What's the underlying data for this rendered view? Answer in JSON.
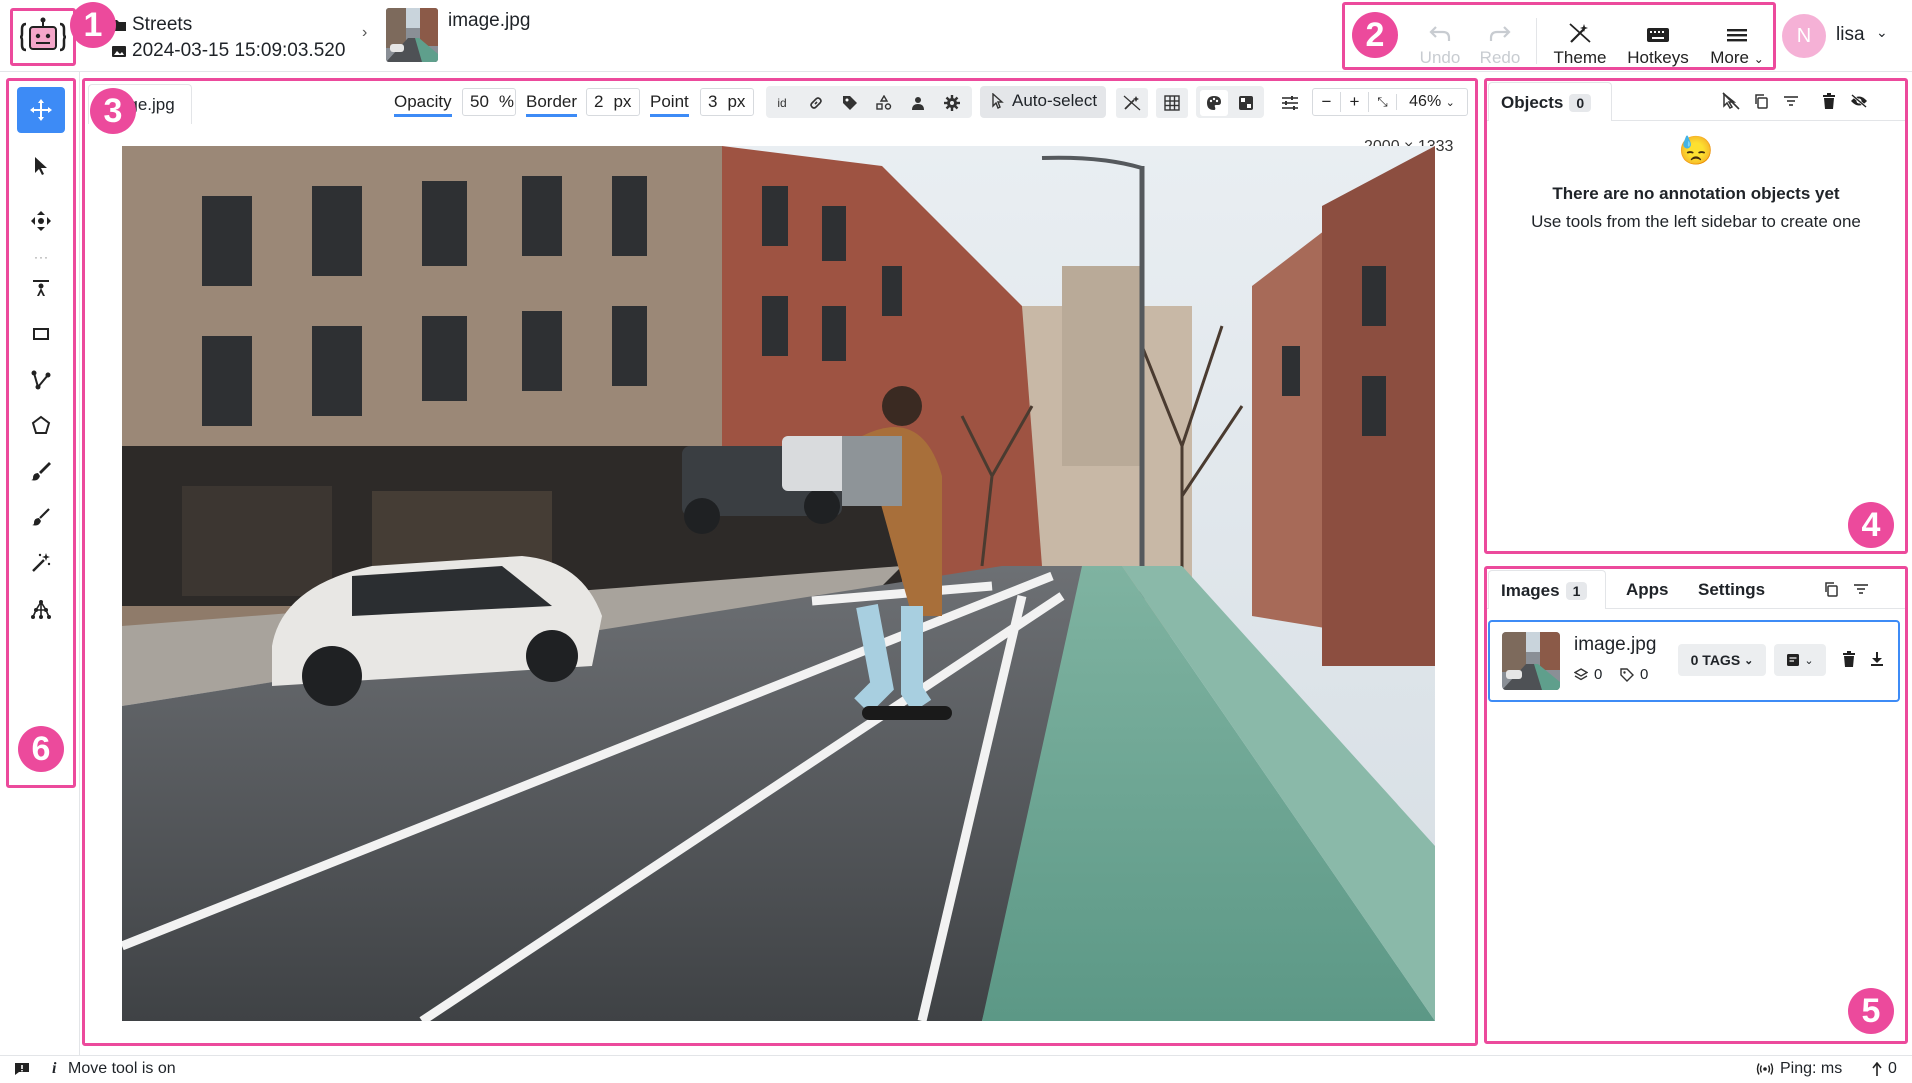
{
  "header": {
    "project_name": "Streets",
    "dataset_date": "2024-03-15 15:09:03.520",
    "image_name": "image.jpg",
    "buttons": {
      "undo": "Undo",
      "redo": "Redo",
      "theme": "Theme",
      "hotkeys": "Hotkeys",
      "more": "More"
    },
    "user": {
      "initial": "N",
      "name": "lisa"
    }
  },
  "canvas_toolbar": {
    "tab_title": "image.jpg",
    "opacity_label": "Opacity",
    "opacity_value": "50",
    "opacity_unit": "%",
    "border_label": "Border",
    "border_value": "2",
    "border_unit": "px",
    "point_label": "Point",
    "point_value": "3",
    "point_unit": "px",
    "id_label": "id",
    "auto_select": "Auto-select",
    "zoom_minus": "−",
    "zoom_plus": "+",
    "zoom": "46%"
  },
  "canvas": {
    "image_size": "2000 × 1333"
  },
  "objects_panel": {
    "tab": "Objects",
    "count": "0",
    "empty_emoji": "😓",
    "empty_title": "There are no annotation objects yet",
    "empty_subtitle": "Use tools from the left sidebar to create one"
  },
  "images_panel": {
    "tabs": {
      "images": "Images",
      "images_count": "1",
      "apps": "Apps",
      "settings": "Settings"
    },
    "item": {
      "name": "image.jpg",
      "objects_count": "0",
      "tags_count": "0",
      "tags_button": "0 TAGS"
    }
  },
  "status_bar": {
    "message_prefix": "i",
    "message": "Move tool is on",
    "ping": "Ping: ms",
    "upload_count": "0"
  },
  "callouts": [
    "1",
    "2",
    "3",
    "4",
    "5",
    "6"
  ],
  "colors": {
    "accent": "#3d8bf6",
    "highlight": "#ec4a9c",
    "bike_lane": "#5f9f8c"
  }
}
